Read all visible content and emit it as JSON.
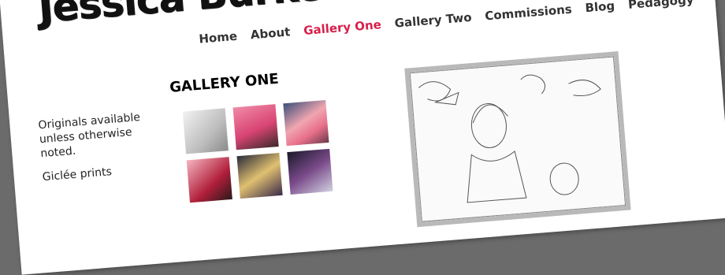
{
  "site": {
    "title": "Jessica Burke"
  },
  "nav": {
    "items": [
      {
        "label": "Home"
      },
      {
        "label": "About"
      },
      {
        "label": "Gallery One",
        "active": true
      },
      {
        "label": "Gallery Two"
      },
      {
        "label": "Commissions"
      },
      {
        "label": "Blog"
      },
      {
        "label": "Pedagogy"
      }
    ],
    "active_color": "#d6204b"
  },
  "gallery": {
    "heading": "GALLERY ONE"
  },
  "sidebar": {
    "note": "Originals available unless otherwise noted.",
    "note2": "Giclée prints"
  },
  "thumbnails": [
    {
      "name": "pencil portrait sketch"
    },
    {
      "name": "figure on pink background"
    },
    {
      "name": "pink rabbit figure"
    },
    {
      "name": "figure in red hat"
    },
    {
      "name": "colorful face"
    },
    {
      "name": "portrait in purple tones"
    }
  ]
}
